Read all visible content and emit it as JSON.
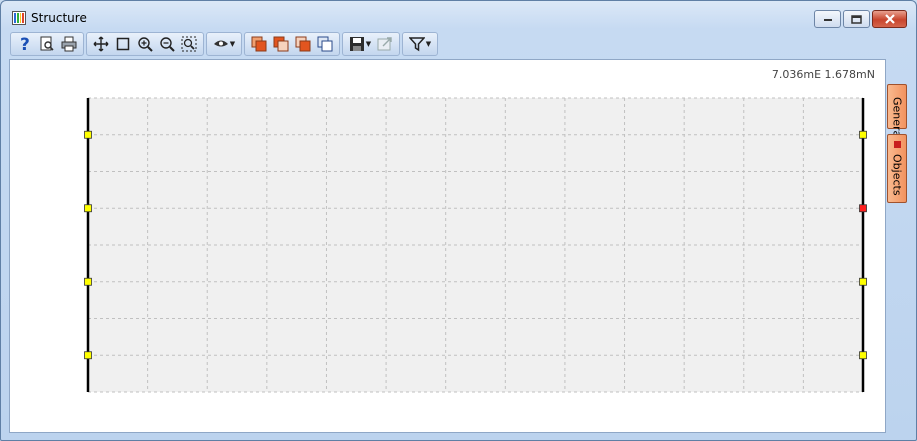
{
  "window": {
    "title": "Structure",
    "controls": [
      "minimize",
      "maximize",
      "close"
    ]
  },
  "toolbar": {
    "groups": [
      [
        "help-icon",
        "print-preview-icon",
        "print-icon"
      ],
      [
        "pan-icon",
        "select-rectangle-icon",
        "zoom-in-icon",
        "zoom-out-icon",
        "zoom-extents-icon"
      ],
      [
        "view-dropdown-icon"
      ],
      [
        "layer-orange-icon",
        "layer-copy-icon",
        "layer-orange-2-icon",
        "layer-blue-icon"
      ],
      [
        "save-dropdown-icon",
        "export-disabled-icon"
      ],
      [
        "filter-dropdown-icon"
      ]
    ]
  },
  "canvas": {
    "coordinate_readout": "7.036mE 1.678mN",
    "colors": {
      "grid_background": "#f0f0f0",
      "grid_line": "#c0c0c0",
      "wall_line": "#000000",
      "node_default": "#ffff00",
      "node_selected": "#ff2020"
    },
    "grid": {
      "columns": 13,
      "rows": 8
    },
    "left_nodes": 4,
    "right_nodes": 4,
    "selected_right_node_index": 1
  },
  "side_panel": {
    "tabs": [
      {
        "label": "General",
        "color": "#1e9b1e"
      },
      {
        "label": "Objects",
        "color": "#c81e1e"
      }
    ]
  }
}
